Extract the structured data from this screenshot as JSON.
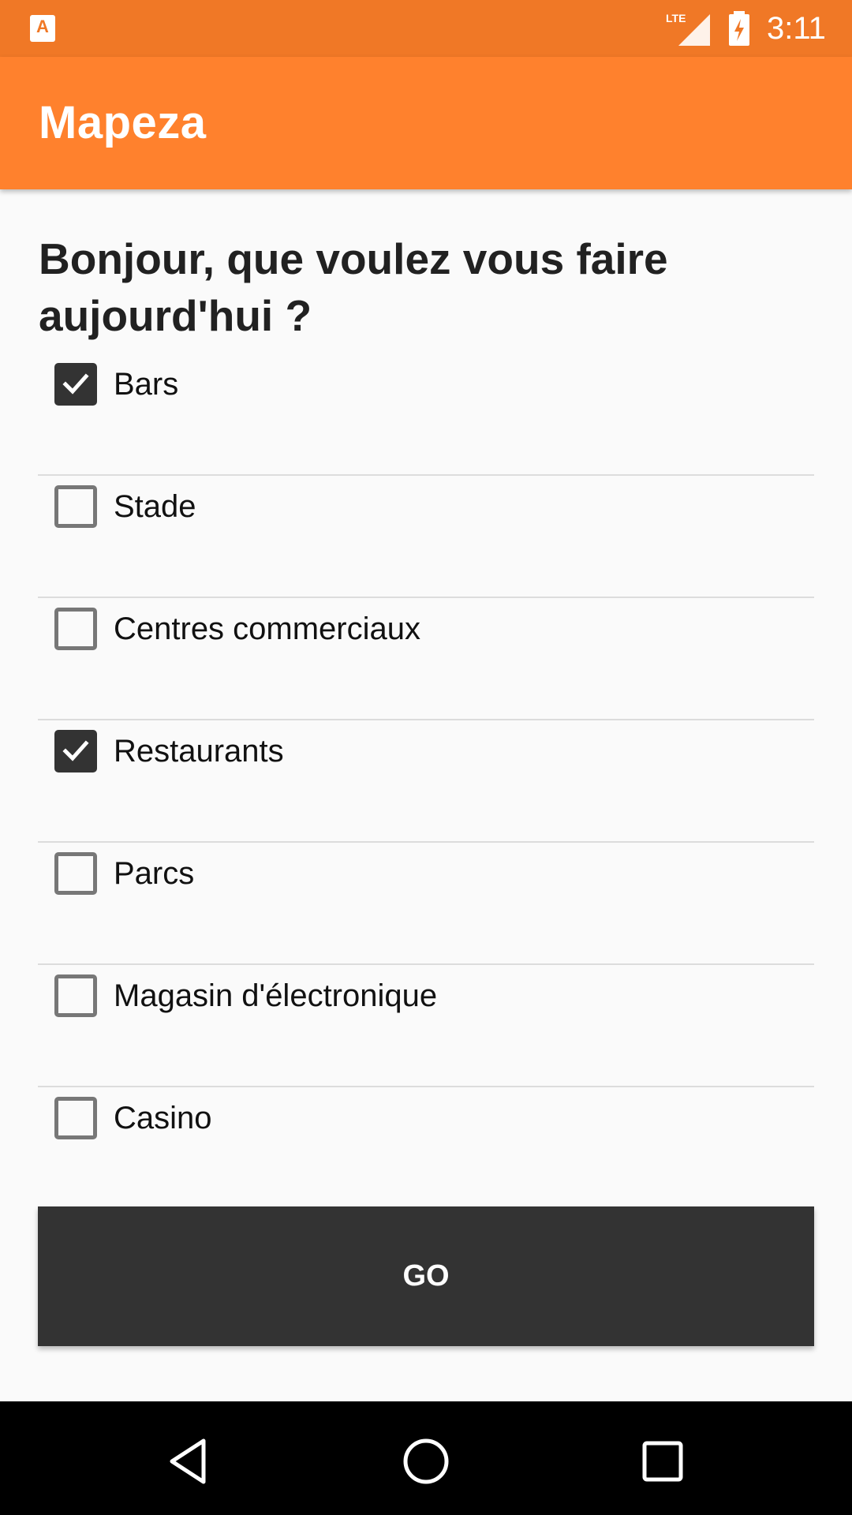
{
  "status_bar": {
    "app_icon": "app-store-icon",
    "network": "LTE",
    "battery": "battery-charging-icon",
    "time": "3:11",
    "color": "#f07826"
  },
  "app_bar": {
    "title": "Mapeza",
    "color": "#ff812d"
  },
  "main": {
    "heading": "Bonjour, que voulez vous faire aujourd'hui ?",
    "options": [
      {
        "label": "Bars",
        "checked": true
      },
      {
        "label": "Stade",
        "checked": false
      },
      {
        "label": "Centres commerciaux",
        "checked": false
      },
      {
        "label": "Restaurants",
        "checked": true
      },
      {
        "label": "Parcs",
        "checked": false
      },
      {
        "label": "Magasin d'électronique",
        "checked": false
      },
      {
        "label": "Casino",
        "checked": false
      }
    ],
    "go_label": "GO"
  },
  "nav_bar": {
    "back": "back-triangle-icon",
    "home": "home-circle-icon",
    "recent": "recent-apps-square-icon"
  }
}
